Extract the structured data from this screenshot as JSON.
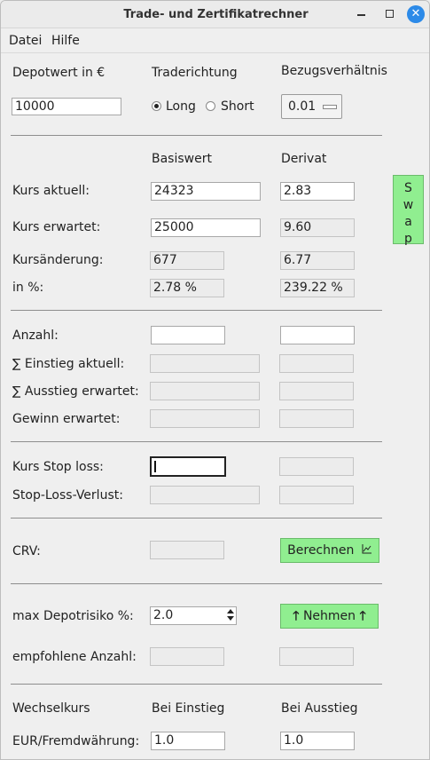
{
  "window": {
    "title": "Trade- und Zertifikatrechner"
  },
  "titlebar_icons": {
    "minimize": "minimize-icon",
    "maximize": "maximize-icon",
    "close": "close-icon",
    "close_color": "#2c8ae8"
  },
  "menu": {
    "datei": "Datei",
    "hilfe": "Hilfe"
  },
  "top": {
    "depotwert_label": "Depotwert in €",
    "depotwert_value": "10000",
    "traderichtung_label": "Traderichtung",
    "long_label": "Long",
    "short_label": "Short",
    "bezug_label": "Bezugsverhältnis",
    "bezug_value": "0.01"
  },
  "headers": {
    "basiswert": "Basiswert",
    "derivat": "Derivat"
  },
  "kurs": {
    "aktuell_label": "Kurs aktuell:",
    "aktuell_basis": "24323",
    "aktuell_derivat": "2.83",
    "erwartet_label": "Kurs erwartet:",
    "erwartet_basis": "25000",
    "erwartet_derivat": "9.60",
    "aenderung_label": "Kursänderung:",
    "aenderung_basis": "677",
    "aenderung_derivat": "6.77",
    "prozent_label": "in %:",
    "prozent_basis": "2.78 %",
    "prozent_derivat": "239.22 %"
  },
  "swap": {
    "letters": [
      "S",
      "w",
      "a",
      "p"
    ],
    "color": "#90ee90"
  },
  "position": {
    "anzahl_label": "Anzahl:",
    "einstieg_label": "∑ Einstieg aktuell:",
    "ausstieg_label": "∑ Ausstieg erwartet:",
    "gewinn_label": "Gewinn erwartet:"
  },
  "stoploss": {
    "kurs_label": "Kurs Stop loss:",
    "verlust_label": "Stop-Loss-Verlust:"
  },
  "crv": {
    "label": "CRV:",
    "button_label": "Berechnen",
    "button_icon": "chart-icon"
  },
  "risiko": {
    "label": "max Depotrisiko %:",
    "value": "2.0",
    "button_label": "Nehmen",
    "button_icon": "arrow-up-icon",
    "empfohlen_label": "empfohlene Anzahl:"
  },
  "wechsel": {
    "label": "Wechselkurs",
    "einstieg_header": "Bei Einstieg",
    "ausstieg_header": "Bei Ausstieg",
    "eur_label": "EUR/Fremdwährung:",
    "einstieg_value": "1.0",
    "ausstieg_value": "1.0"
  }
}
